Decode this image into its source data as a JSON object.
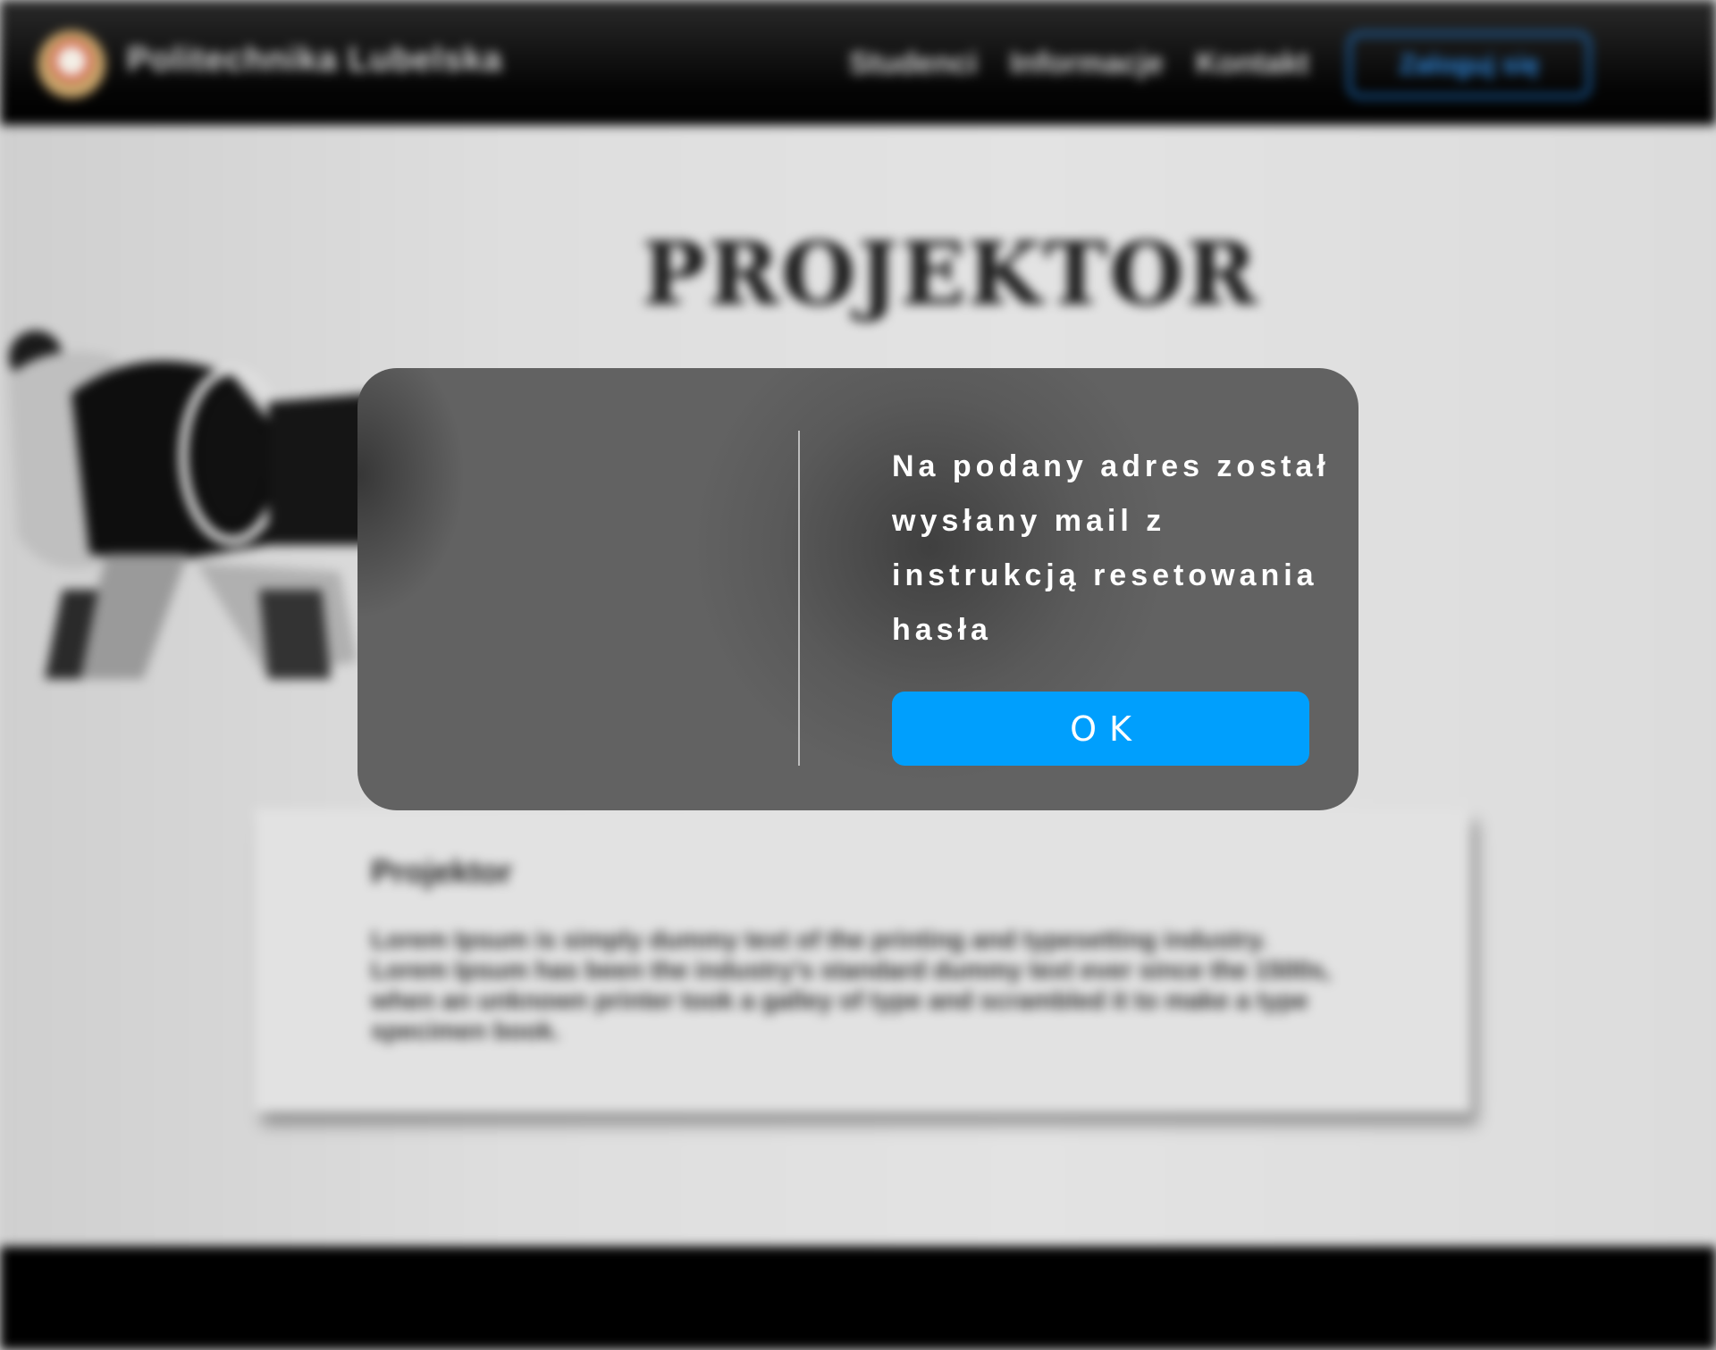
{
  "header": {
    "brand": "Politechnika Lubelska",
    "nav": [
      "Studenci",
      "Informacje",
      "Kontakt"
    ],
    "login_label": "Zaloguj się"
  },
  "main": {
    "hero_title": "PROJEKTOR",
    "card": {
      "title": "Projektor",
      "text": "Lorem Ipsum is simply dummy text of the printing and typesetting industry. Lorem Ipsum has been the industry's standard dummy text ever since the 1500s, when an unknown printer took a galley of type and scrambled it to make a type specimen book."
    }
  },
  "modal": {
    "message": "Na podany adres został wysłany mail z instrukcją resetowania hasła",
    "ok_label": "OK"
  },
  "colors": {
    "accent": "#009ffd",
    "modal_bg": "#636363",
    "header_bg": "#000000"
  }
}
